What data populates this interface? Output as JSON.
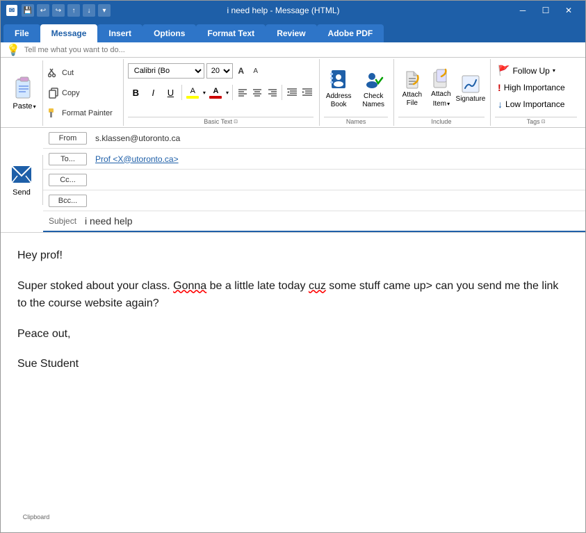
{
  "window": {
    "title": "i need help - Message (HTML)",
    "title_bar_icon": "✉"
  },
  "tabs": [
    {
      "label": "File",
      "active": false
    },
    {
      "label": "Message",
      "active": true
    },
    {
      "label": "Insert",
      "active": false
    },
    {
      "label": "Options",
      "active": false
    },
    {
      "label": "Format Text",
      "active": false
    },
    {
      "label": "Review",
      "active": false
    },
    {
      "label": "Adobe PDF",
      "active": false
    }
  ],
  "tell_me": {
    "placeholder": "Tell me what you want to do..."
  },
  "clipboard": {
    "paste_label": "Paste",
    "cut_label": "Cut",
    "copy_label": "Copy",
    "format_painter_label": "Format Painter",
    "group_label": "Clipboard"
  },
  "basic_text": {
    "font": "Calibri (Bo",
    "font_size": "20",
    "group_label": "Basic Text"
  },
  "names": {
    "address_book_label": "Address\nBook",
    "check_names_label": "Check\nNames",
    "group_label": "Names"
  },
  "include": {
    "attach_file_label": "Attach\nFile",
    "attach_item_label": "Attach\nItem",
    "signature_label": "Signature",
    "group_label": "Include"
  },
  "tags": {
    "follow_up_label": "Follow Up",
    "high_importance_label": "High Importance",
    "low_importance_label": "Low Importance",
    "group_label": "Tags"
  },
  "email": {
    "from_label": "From",
    "from_value": "s.klassen@utoronto.ca",
    "to_label": "To...",
    "to_value": "Prof <X@utoronto.ca>",
    "cc_label": "Cc...",
    "bcc_label": "Bcc...",
    "subject_label": "Subject",
    "subject_value": "i need help",
    "send_label": "Send"
  },
  "body": {
    "line1": "Hey prof!",
    "line2_before": "Super stoked about your class. ",
    "line2_gonna": "Gonna",
    "line2_mid": " be a little late today ",
    "line2_cuz": "cuz",
    "line2_end": " some stuff came up> can you send me the link to the course website again?",
    "line3": "Peace out,",
    "line4": "Sue Student"
  }
}
